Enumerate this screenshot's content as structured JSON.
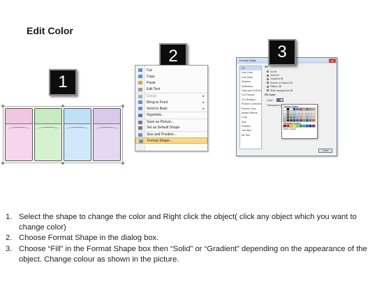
{
  "title": "Edit Color",
  "badges": [
    "1",
    "2",
    "3"
  ],
  "shapes": [
    {
      "color": "#f7d5ec",
      "cap": "#f1c6e3",
      "name": "pink"
    },
    {
      "color": "#d4f2cf",
      "cap": "#c6ebbf",
      "name": "green"
    },
    {
      "color": "#cfe9fb",
      "cap": "#bfe1f8",
      "name": "blue"
    },
    {
      "color": "#e6d7f3",
      "cap": "#dac8ee",
      "name": "purple"
    }
  ],
  "context_menu": {
    "items": [
      {
        "label": "Cut",
        "disabled": false
      },
      {
        "label": "Copy",
        "disabled": false
      },
      {
        "label": "Paste",
        "disabled": false
      },
      {
        "label": "Edit Text",
        "disabled": false
      },
      {
        "label": "Group",
        "disabled": true,
        "submenu": true
      },
      {
        "label": "Bring to Front",
        "disabled": false,
        "submenu": true
      },
      {
        "label": "Send to Back",
        "disabled": false,
        "submenu": true
      },
      {
        "label": "Hyperlink...",
        "disabled": false
      },
      {
        "label": "Save as Picture...",
        "disabled": false
      },
      {
        "label": "Set as Default Shape",
        "disabled": false
      },
      {
        "label": "Size and Position...",
        "disabled": false
      },
      {
        "label": "Format Shape...",
        "disabled": false,
        "highlight": true
      }
    ]
  },
  "dialog": {
    "title": "Format Shape",
    "close_label": "Close",
    "sidebar": [
      "Fill",
      "Line Color",
      "Line Style",
      "Shadow",
      "Reflection",
      "Glow and Soft Edges",
      "3-D Format",
      "3-D Rotation",
      "Picture Corrections",
      "Picture Color",
      "Artistic Effects",
      "Crop",
      "Size",
      "Position",
      "Text Box",
      "Alt Text"
    ],
    "section": "Fill",
    "fill_options": [
      "No fill",
      "Solid fill",
      "Gradient fill",
      "Picture or texture fill",
      "Pattern fill",
      "Slide background fill"
    ],
    "selected_fill": 1,
    "fill_color_section": "Fill Color",
    "color_label": "Color:",
    "transparency_label": "Transparency:",
    "palette": {
      "theme_label": "Theme Colors",
      "standard_label": "Standard Colors",
      "more_label": "More Colors...",
      "theme_colors": [
        "#ffffff",
        "#000000",
        "#eeece1",
        "#1f497d",
        "#4f81bd",
        "#c0504d",
        "#9bbb59",
        "#8064a2",
        "#4bacc6",
        "#f79646"
      ],
      "shade_rows": [
        [
          "#f2f2f2",
          "#7f7f7f",
          "#ddd9c3",
          "#c6d9f0",
          "#dbe5f1",
          "#f2dcdb",
          "#ebf1dd",
          "#e5e0ec",
          "#dbeef3",
          "#fdeada"
        ],
        [
          "#d8d8d8",
          "#595959",
          "#c4bd97",
          "#8db3e2",
          "#b8cce4",
          "#e5b9b7",
          "#d7e3bc",
          "#ccc1d9",
          "#b7dde8",
          "#fbd5b5"
        ],
        [
          "#bfbfbf",
          "#3f3f3f",
          "#938953",
          "#548dd4",
          "#95b3d7",
          "#d99694",
          "#c3d69b",
          "#b2a2c7",
          "#92cddc",
          "#fac08f"
        ],
        [
          "#a5a5a5",
          "#262626",
          "#494429",
          "#17365d",
          "#366092",
          "#953734",
          "#76923c",
          "#5f497a",
          "#31859b",
          "#e36c09"
        ]
      ],
      "standard_colors": [
        "#c00000",
        "#ff0000",
        "#ffc000",
        "#ffff00",
        "#92d050",
        "#00b050",
        "#00b0f0",
        "#0070c0",
        "#002060",
        "#7030a0"
      ]
    }
  },
  "instructions": [
    {
      "num": "1.",
      "text": "Select the shape to change the color and Right click the object( click any object which you want to change color)"
    },
    {
      "num": "2.",
      "text": "Choose Format Shape in the dialog box."
    },
    {
      "num": "3.",
      "text": "Choose “Fill” in the Format Shape box then “Solid” or “Gradient” depending on the appearance of the object. Change colour as shown in the picture."
    }
  ]
}
